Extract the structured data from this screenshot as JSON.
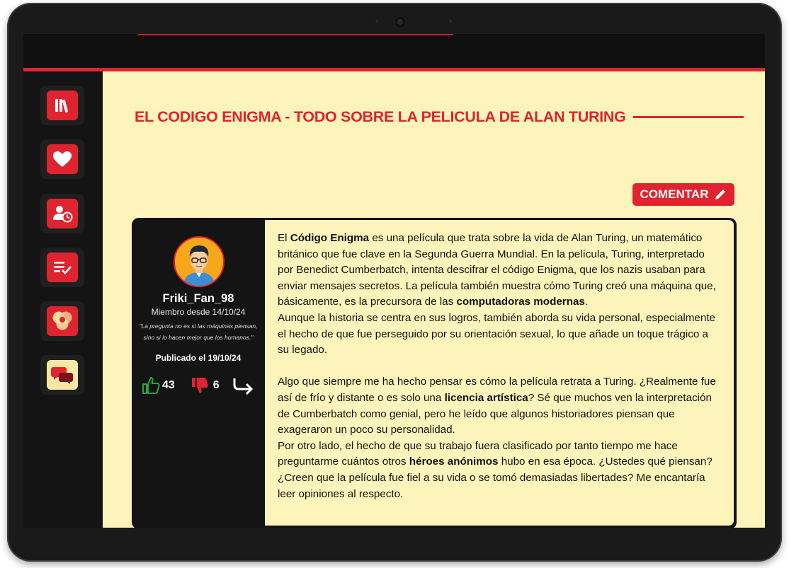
{
  "sidebar": {
    "items": [
      {
        "name": "library-icon"
      },
      {
        "name": "heart-icon"
      },
      {
        "name": "user-clock-icon"
      },
      {
        "name": "checklist-icon"
      },
      {
        "name": "venn-icon"
      },
      {
        "name": "chat-bubbles-icon"
      }
    ]
  },
  "page": {
    "title": "EL CODIGO ENIGMA - TODO SOBRE LA PELICULA DE ALAN TURING",
    "comment_button": "COMENTAR"
  },
  "post": {
    "author": {
      "username": "Friki_Fan_98",
      "member_since": "Miembro desde 14/10/24",
      "quote_line1": "\"La pregunta no es si las máquinas piensan,",
      "quote_line2": "sino si lo hacen mejor que los humanos.\""
    },
    "published": "Publicado el 19/10/24",
    "likes": "43",
    "dislikes": "6",
    "p1": {
      "t1": "El ",
      "b1": "Código Enigma",
      "t2": " es una película que trata sobre la vida de Alan Turing, un matemático británico que fue clave en la Segunda Guerra Mundial. En la película, Turing, interpretado por Benedict Cumberbatch, intenta descifrar el código Enigma, que los nazis usaban para enviar mensajes secretos. La película también muestra cómo Turing creó una máquina que, básicamente, es la precursora de las ",
      "b2": "computadoras modernas",
      "t3": "."
    },
    "p2": "Aunque la historia se centra en sus logros, también aborda su vida personal, especialmente el hecho de que fue perseguido por su orientación sexual, lo que añade un toque trágico a su legado.",
    "p3": {
      "t1": "Algo que siempre me ha hecho pensar es cómo la película retrata a Turing. ¿Realmente fue así de frío y distante o es solo una ",
      "b1": "licencia artística",
      "t2": "? Sé que muchos ven la interpretación de Cumberbatch como genial, pero he leído que algunos historiadores piensan que exageraron un poco su personalidad."
    },
    "p4": {
      "t1": "Por otro lado, el hecho de que su trabajo fuera clasificado por tanto tiempo me hace preguntarme cuántos otros ",
      "b1": "héroes anónimos",
      "t2": " hubo en esa época. ¿Ustedes qué piensan? ¿Creen que la película fue fiel a su vida o se tomó demasiadas libertades? Me encantaría leer opiniones al respecto."
    }
  },
  "colors": {
    "accent": "#e0242f",
    "background": "#fdf4bb",
    "dark": "#141414",
    "like": "#2aa43b"
  }
}
